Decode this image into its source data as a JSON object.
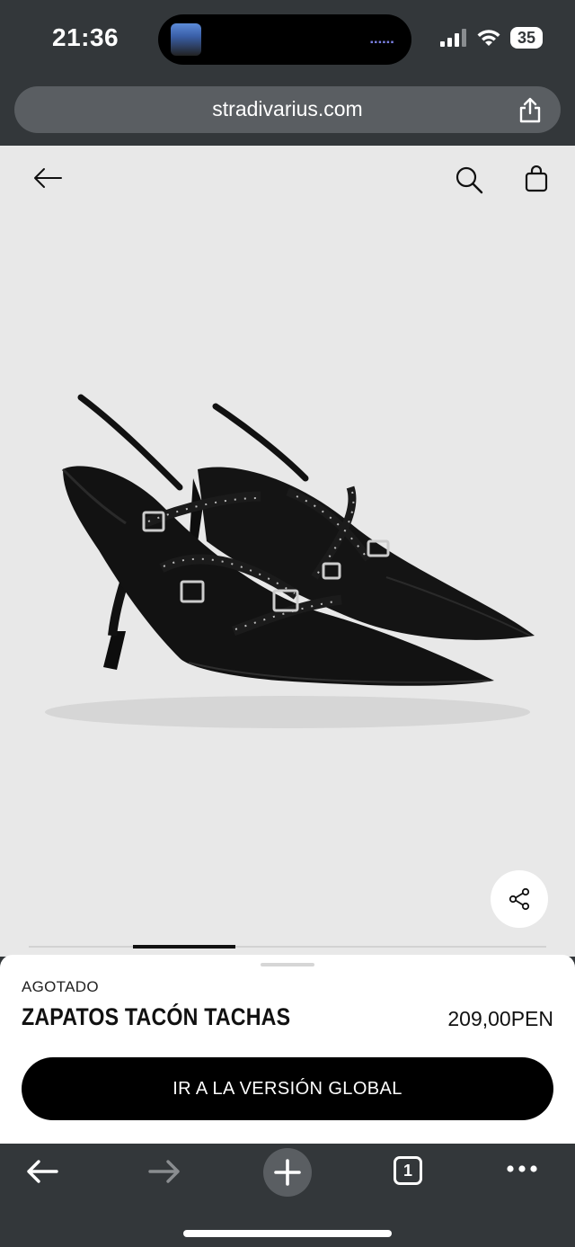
{
  "status_bar": {
    "time": "21:36",
    "battery": "35"
  },
  "browser": {
    "url": "stradivarius.com"
  },
  "product": {
    "status": "AGOTADO",
    "name": "ZAPATOS TACÓN TACHAS",
    "price": "209,00PEN",
    "cta_label": "IR A LA VERSIÓN GLOBAL"
  },
  "toolbar": {
    "tab_count": "1"
  },
  "colors": {
    "sheet_bg": "#ffffff",
    "cta_bg": "#000000",
    "image_bg": "#e8e8e8",
    "chrome_bg": "#33373a"
  },
  "icons": {
    "header": [
      "back-arrow-icon",
      "search-icon",
      "shopping-bag-icon"
    ],
    "browser": [
      "share-icon",
      "back-icon",
      "forward-icon",
      "new-tab-icon",
      "tabs-icon",
      "more-icon"
    ]
  }
}
